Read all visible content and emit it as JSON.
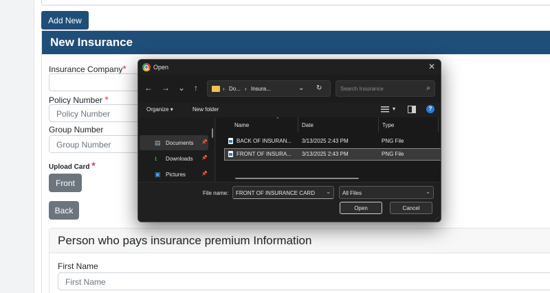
{
  "page": {
    "add_new_label": "Add New",
    "card_title": "New Insurance",
    "fields": {
      "insurance_company_label": "Insurance Company",
      "policy_number_label": "Policy Number",
      "policy_number_placeholder": "Policy Number",
      "group_number_label": "Group Number",
      "group_number_placeholder": "Group Number",
      "upload_card_label": "Upload Card",
      "required_mark": "*"
    },
    "buttons": {
      "front": "Front",
      "back": "Back"
    },
    "payer_section": {
      "title": "Person who pays insurance premium Information",
      "first_name_label": "First Name",
      "first_name_placeholder": "First Name"
    }
  },
  "dialog": {
    "title": "Open",
    "close_glyph": "✕",
    "nav": {
      "back": "←",
      "forward": "→",
      "recent": "⌄",
      "up": "↑",
      "refresh": "↻"
    },
    "address": {
      "crumb_sep": "›",
      "crumb_1": "Do...",
      "crumb_2": "Insura...",
      "dropdown": "⌄"
    },
    "search_placeholder": "Search Insurance",
    "search_glyph": "⌕",
    "toolbar": {
      "organize": "Organize",
      "organize_caret": "▾",
      "new_folder": "New folder",
      "view_caret": "▾",
      "help_glyph": "?"
    },
    "sidebar": [
      {
        "label": "Documents",
        "icon": "document-icon",
        "glyph": "▤",
        "pinned": true,
        "active": true
      },
      {
        "label": "Downloads",
        "icon": "download-icon",
        "glyph": "⭳",
        "pinned": true,
        "active": false
      },
      {
        "label": "Pictures",
        "icon": "picture-icon",
        "glyph": "▣",
        "pinned": true,
        "active": false
      }
    ],
    "pin_glyph": "📌",
    "columns": {
      "name": "Name",
      "date": "Date",
      "type": "Type",
      "sort_glyph": "⌃"
    },
    "files": [
      {
        "name": "BACK OF INSURAN...",
        "date": "3/13/2025 2:43 PM",
        "type": "PNG File",
        "selected": false
      },
      {
        "name": "FRONT OF INSURA...",
        "date": "3/13/2025 2:43 PM",
        "type": "PNG File",
        "selected": true
      }
    ],
    "file_name_label": "File name:",
    "file_name_value": "FRONT OF INSURANCE CARD",
    "file_type_value": "All Files",
    "select_caret": "⌄",
    "open_label": "Open",
    "cancel_label": "Cancel",
    "grip_glyph": "⋰"
  },
  "colors": {
    "primary": "#1f4e79",
    "secondary": "#6c757d",
    "danger": "#dc3545",
    "dialog_bg": "#202020"
  }
}
